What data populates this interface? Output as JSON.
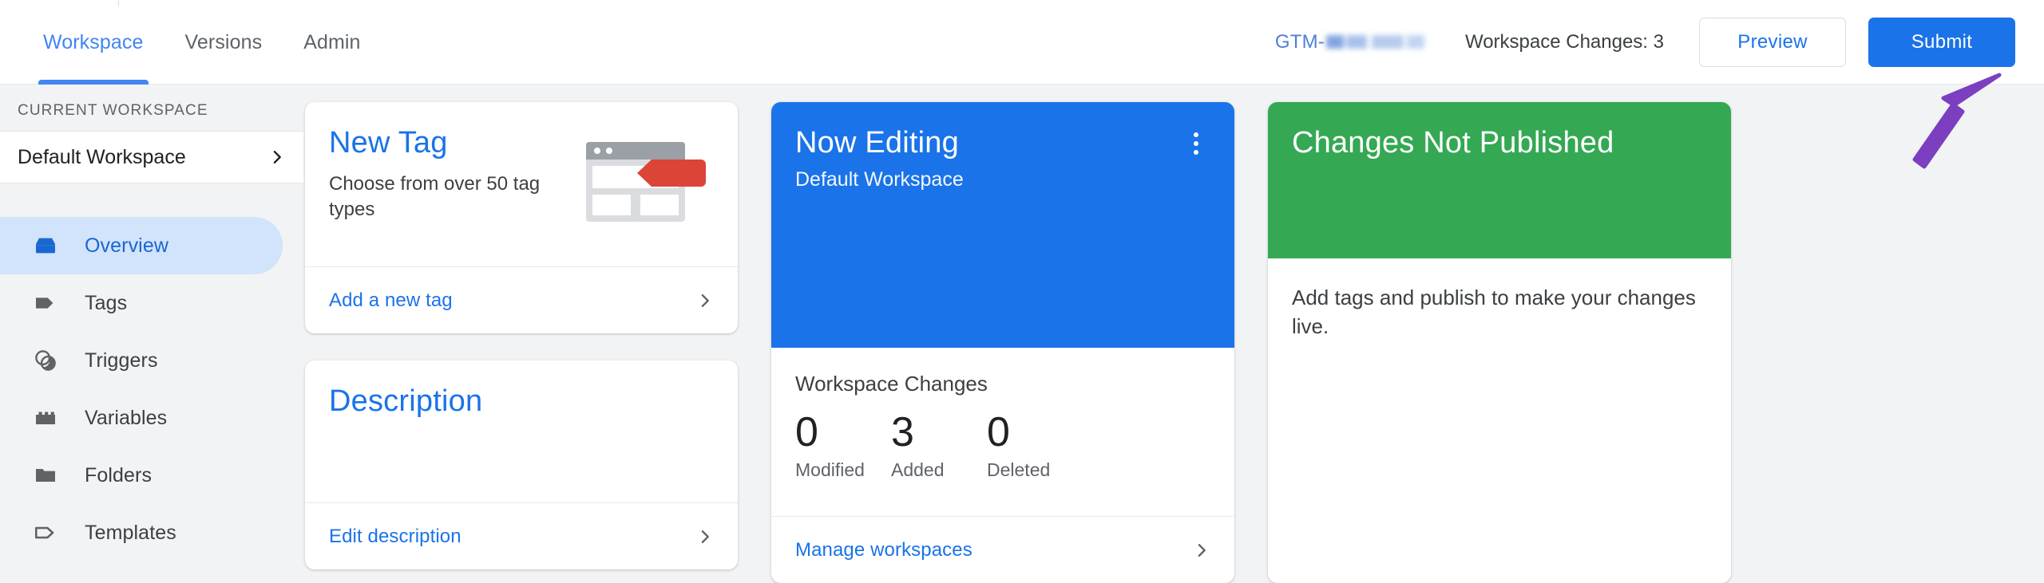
{
  "header": {
    "tabs": [
      {
        "label": "Workspace",
        "active": true
      },
      {
        "label": "Versions",
        "active": false
      },
      {
        "label": "Admin",
        "active": false
      }
    ],
    "container_id_prefix": "GTM-",
    "container_id_redacted": true,
    "workspace_changes_summary": "Workspace Changes: 3",
    "preview_label": "Preview",
    "submit_label": "Submit"
  },
  "sidebar": {
    "section_label": "CURRENT WORKSPACE",
    "current_workspace": "Default Workspace",
    "items": [
      {
        "label": "Overview",
        "icon": "overview-icon",
        "active": true
      },
      {
        "label": "Tags",
        "icon": "tag-icon",
        "active": false
      },
      {
        "label": "Triggers",
        "icon": "triggers-icon",
        "active": false
      },
      {
        "label": "Variables",
        "icon": "variables-icon",
        "active": false
      },
      {
        "label": "Folders",
        "icon": "folder-icon",
        "active": false
      },
      {
        "label": "Templates",
        "icon": "template-icon",
        "active": false
      }
    ]
  },
  "cards": {
    "new_tag": {
      "title": "New Tag",
      "subtitle": "Choose from over 50 tag types",
      "footer_link": "Add a new tag",
      "illustration": "browser-window-with-tag-illustration"
    },
    "description": {
      "title": "Description",
      "body": "",
      "footer_link": "Edit description"
    },
    "now_editing": {
      "title": "Now Editing",
      "subtitle": "Default Workspace",
      "menu_icon": "kebab-menu-icon",
      "changes_heading": "Workspace Changes",
      "stats": [
        {
          "value": "0",
          "label": "Modified"
        },
        {
          "value": "3",
          "label": "Added"
        },
        {
          "value": "0",
          "label": "Deleted"
        }
      ],
      "footer_link": "Manage workspaces"
    },
    "changes_not_published": {
      "title": "Changes Not Published",
      "body": "Add tags and publish to make your changes live."
    }
  },
  "annotation": {
    "shape": "arrow",
    "points_to": "Submit",
    "color": "#7B3FBF"
  },
  "colors": {
    "accent_blue": "#1a73e8",
    "tab_blue": "#4285f4",
    "green": "#34a853",
    "page_bg": "#f1f3f4",
    "card_bg": "#ffffff",
    "text_primary": "#3c4043",
    "text_secondary": "#5f6368",
    "annotation_purple": "#7B3FBF"
  }
}
